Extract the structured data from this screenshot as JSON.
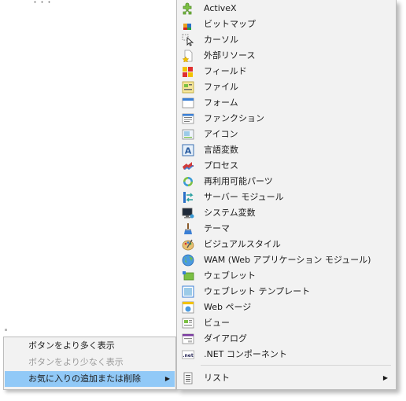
{
  "background": {
    "partial_text": "・・・"
  },
  "left_menu": {
    "items": [
      {
        "label": "ボタンをより多く表示",
        "disabled": false
      },
      {
        "label": "ボタンをより少なく表示",
        "disabled": true
      },
      {
        "label": "お気に入りの追加または削除",
        "disabled": false,
        "highlighted": true,
        "submenu_arrow": "▶"
      }
    ]
  },
  "right_menu": {
    "items": [
      {
        "label": "ActiveX",
        "icon": "activex-puzzle-icon"
      },
      {
        "label": "ビットマップ",
        "icon": "bitmap-icon"
      },
      {
        "label": "カーソル",
        "icon": "cursor-icon"
      },
      {
        "label": "外部リソース",
        "icon": "external-resource-icon"
      },
      {
        "label": "フィールド",
        "icon": "field-icon"
      },
      {
        "label": "ファイル",
        "icon": "file-icon"
      },
      {
        "label": "フォーム",
        "icon": "form-icon"
      },
      {
        "label": "ファンクション",
        "icon": "function-icon"
      },
      {
        "label": "アイコン",
        "icon": "icon-resource-icon"
      },
      {
        "label": "言語変数",
        "icon": "language-variable-icon"
      },
      {
        "label": "プロセス",
        "icon": "process-icon"
      },
      {
        "label": "再利用可能パーツ",
        "icon": "reusable-part-icon"
      },
      {
        "label": "サーバー モジュール",
        "icon": "server-module-icon"
      },
      {
        "label": "システム変数",
        "icon": "system-variable-icon"
      },
      {
        "label": "テーマ",
        "icon": "theme-icon"
      },
      {
        "label": "ビジュアルスタイル",
        "icon": "visual-style-icon"
      },
      {
        "label": "WAM (Web アプリケーション モジュール)",
        "icon": "wam-globe-icon"
      },
      {
        "label": "ウェブレット",
        "icon": "weblet-icon"
      },
      {
        "label": "ウェブレット テンプレート",
        "icon": "weblet-template-icon"
      },
      {
        "label": "Web ページ",
        "icon": "web-page-icon"
      },
      {
        "label": "ビュー",
        "icon": "view-icon"
      },
      {
        "label": "ダイアログ",
        "icon": "dialog-icon"
      },
      {
        "label": ".NET コンポーネント",
        "icon": "dotnet-component-icon"
      }
    ],
    "list_item": {
      "label": "リスト",
      "icon": "list-icon",
      "submenu_arrow": "▶"
    }
  },
  "colors": {
    "menu_bg": "#f2f2f2",
    "highlight": "#91c9f7",
    "disabled_text": "#9a9a9a"
  }
}
